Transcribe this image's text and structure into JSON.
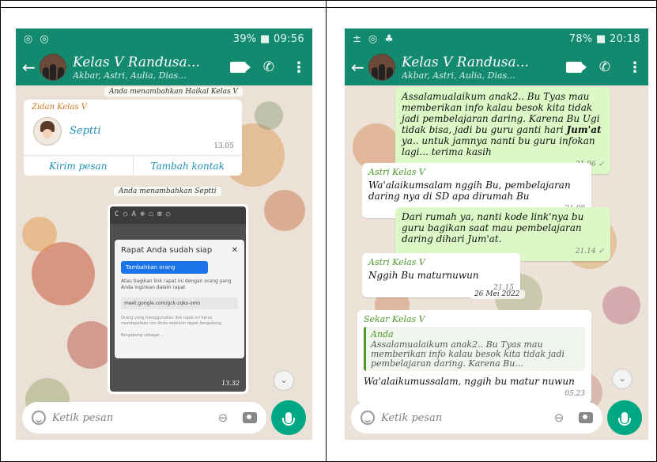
{
  "left": {
    "status": {
      "left_icons": [
        "◎",
        "◎"
      ],
      "right_text": "39% ■ 09:56"
    },
    "header": {
      "title": "Kelas V Randusa...",
      "subtitle": "Akbar, Astri, Aulia, Dias..."
    },
    "system_top": "Anda menambahkan Haikal Kelas V",
    "contact_card": {
      "sender": "Zidan Kelas V",
      "name": "Septti",
      "time": "13.05",
      "action_message": "Kirim pesan",
      "action_add": "Tambah kontak"
    },
    "system_mid": "Anda menambahkan Septti",
    "image_message": {
      "browser_url": "C  ○ A ⊕ ☐ ⊞ ○",
      "meet_title": "Rapat Anda sudah siap",
      "meet_close": "✕",
      "meet_add": "Tambahkan orang",
      "meet_text": "Atau bagikan link rapat ini dengan orang yang Anda inginkan dalam rapat",
      "meet_link": "meet.google.com/gck-zqko-smo",
      "meet_note": "Orang yang menggunakan link rapat ini harus mendapatkan izin Anda sebelum dapat bergabung",
      "meet_joined": "Bergabung sebagai ...",
      "time": "13.32"
    },
    "input": {
      "placeholder": "Ketik pesan"
    }
  },
  "right": {
    "status": {
      "left_icons": [
        "±",
        "◎",
        "♣"
      ],
      "right_text": "78% ■ 20:18"
    },
    "header": {
      "title": "Kelas V Randusa...",
      "subtitle": "Akbar, Astri, Aulia, Dias..."
    },
    "msg1": {
      "text_before": "Assalamualaikum anak2.. Bu Tyas mau memberikan info kalau besok kita tidak jadi pembelajaran daring. Karena Bu Ugi tidak bisa, jadi bu guru ganti hari ",
      "text_bold": "Jum'at",
      "text_after": " ya.. untuk jamnya nanti bu guru infokan lagi... terima kasih",
      "time": "21.06 ✓"
    },
    "msg2": {
      "sender": "Astri Kelas V",
      "text": "Wa'alaikumsalam nggih Bu, pembelajaran daring nya di SD apa dirumah Bu",
      "time": "21.08"
    },
    "msg3": {
      "text": "Dari rumah ya, nanti kode link'nya bu guru bagikan saat mau pembelajaran daring dihari Jum'at.",
      "time": "21.14 ✓"
    },
    "msg4": {
      "sender": "Astri Kelas V",
      "text": "Nggih Bu maturnuwun",
      "time": "21.15"
    },
    "date_chip": "26 Mei 2022",
    "msg5": {
      "sender": "Sekar Kelas V",
      "quote_name": "Anda",
      "quote_text": "Assalamualaikum anak2.. Bu Tyas mau memberikan info kalau besok kita tidak jadi pembelajaran daring. Karena Bu...",
      "text": "Wa'alaikumussalam, nggih bu matur nuwun",
      "time": "05.23"
    },
    "input": {
      "placeholder": "Ketik pesan"
    }
  },
  "colors": {
    "header": "#13896f",
    "outgoing": "#dcf8c6",
    "mic": "#00a884"
  }
}
